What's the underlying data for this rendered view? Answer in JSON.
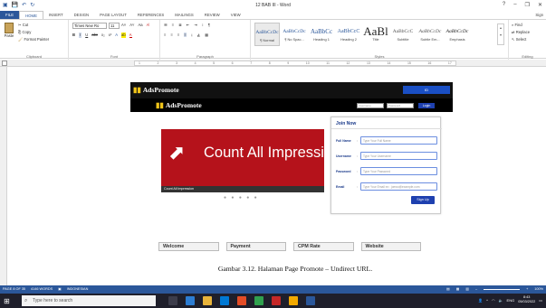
{
  "titlebar": {
    "title": "12 BAB III - Word",
    "help": "?",
    "minimize": "–",
    "restore": "❐",
    "close": "✕"
  },
  "tabs": {
    "file": "FILE",
    "home": "HOME",
    "insert": "INSERT",
    "design": "DESIGN",
    "page_layout": "PAGE LAYOUT",
    "references": "REFERENCES",
    "mailings": "MAILINGS",
    "review": "REVIEW",
    "view": "VIEW",
    "signin": "Sign"
  },
  "ribbon": {
    "clipboard": {
      "paste": "Paste",
      "cut": "Cut",
      "copy": "Copy",
      "format_painter": "Format Painter",
      "label": "Clipboard"
    },
    "font": {
      "name": "Times New Ro",
      "size": "11",
      "label": "Font"
    },
    "paragraph": {
      "label": "Paragraph"
    },
    "styles": {
      "label": "Styles",
      "items": [
        {
          "sample": "AaBbCcDc",
          "name": "¶ Normal"
        },
        {
          "sample": "AaBbCcDc",
          "name": "¶ No Spac..."
        },
        {
          "sample": "AaBbCc",
          "name": "Heading 1"
        },
        {
          "sample": "AaBbCcC",
          "name": "Heading 2"
        },
        {
          "sample": "AaBl",
          "name": "Title"
        },
        {
          "sample": "AaBbCcC",
          "name": "Subtitle"
        },
        {
          "sample": "AaBbCcDc",
          "name": "Subtle Em..."
        },
        {
          "sample": "AaBbCcDc",
          "name": "Emphasis"
        }
      ]
    },
    "editing": {
      "find": "Find",
      "replace": "Replace",
      "select": "Select",
      "label": "Editing"
    }
  },
  "ruler": {
    "marks": [
      "1",
      "2",
      "3",
      "4",
      "5",
      "6",
      "7",
      "8",
      "9",
      "10",
      "11",
      "12",
      "13",
      "14",
      "15",
      "16",
      "17"
    ]
  },
  "document": {
    "site": {
      "brand": "AdsPromote",
      "top_button": "ID",
      "username_placeholder": "Username",
      "password_placeholder": "Password",
      "login": "Login",
      "banner_title": "Count All Impression",
      "banner_caption": "Count All Impression",
      "carousel_dots": "● ● ● ● ●",
      "join": {
        "title": "Join Now",
        "fields": [
          {
            "label": "Full Name",
            "placeholder": "Type Your Full Name"
          },
          {
            "label": "Username",
            "placeholder": "Type Your Username"
          },
          {
            "label": "Password",
            "placeholder": "Type Your Password"
          },
          {
            "label": "Email",
            "placeholder": "Type Your Email ex : joewo@example.com"
          }
        ],
        "signup": "Sign Up"
      },
      "menu": [
        "Welcome",
        "Payment",
        "CPM Rate",
        "Website"
      ]
    },
    "caption": "Gambar 3.12. Halaman Page Promote – Undirect URL."
  },
  "statusbar": {
    "page": "PAGE 8 OF 35",
    "words": "4146 WORDS",
    "language": "INDONESIAN",
    "zoom": "100%"
  },
  "taskbar": {
    "search_placeholder": "Type here to search",
    "tray_lang": "ENG",
    "time": "8:43",
    "date": "05/03/2022"
  },
  "colors": {
    "word_blue": "#2b579a",
    "banner_red": "#b5121b",
    "site_blue": "#1e40af"
  }
}
